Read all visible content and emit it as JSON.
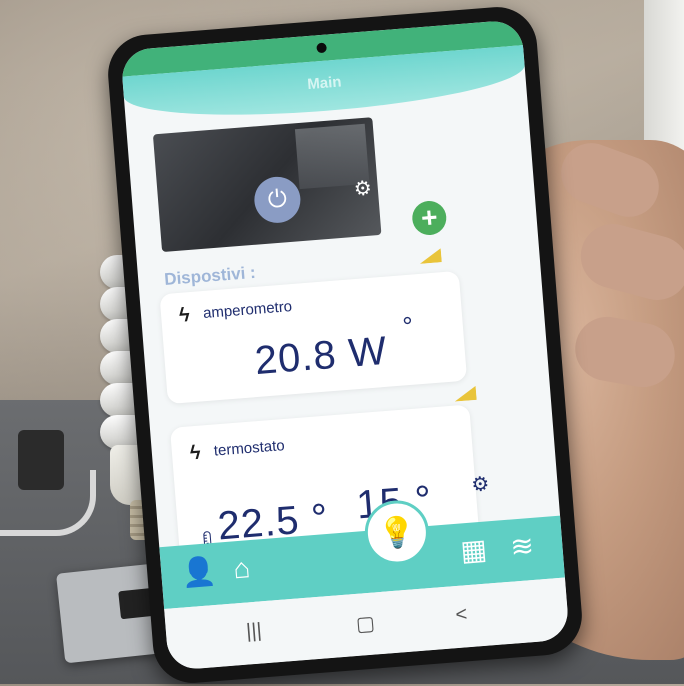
{
  "app": {
    "header_title": "Main"
  },
  "camera": {
    "power_symbol": "⏻",
    "settings_symbol": "⚙"
  },
  "add_button": "+",
  "section": {
    "devices_label": "Dispostivi :"
  },
  "devices": [
    {
      "icon": "bolt",
      "name": "amperometro",
      "value": "20.8 W",
      "degree": "°"
    },
    {
      "icon": "bolt",
      "name": "termostato",
      "value_primary": "22.5 °",
      "value_secondary": "15 °"
    }
  ],
  "bottom_nav": {
    "items": [
      "user-icon",
      "home-icon",
      "bulb-icon",
      "chip-icon",
      "wifi-icon"
    ]
  },
  "system_nav": {
    "recents": "|||",
    "home": "▢",
    "back": "<"
  },
  "colors": {
    "accent": "#5fcfc4",
    "text_dark": "#1f2d6e",
    "wifi_badge": "#e9c43a",
    "add_green": "#4cae5c"
  }
}
